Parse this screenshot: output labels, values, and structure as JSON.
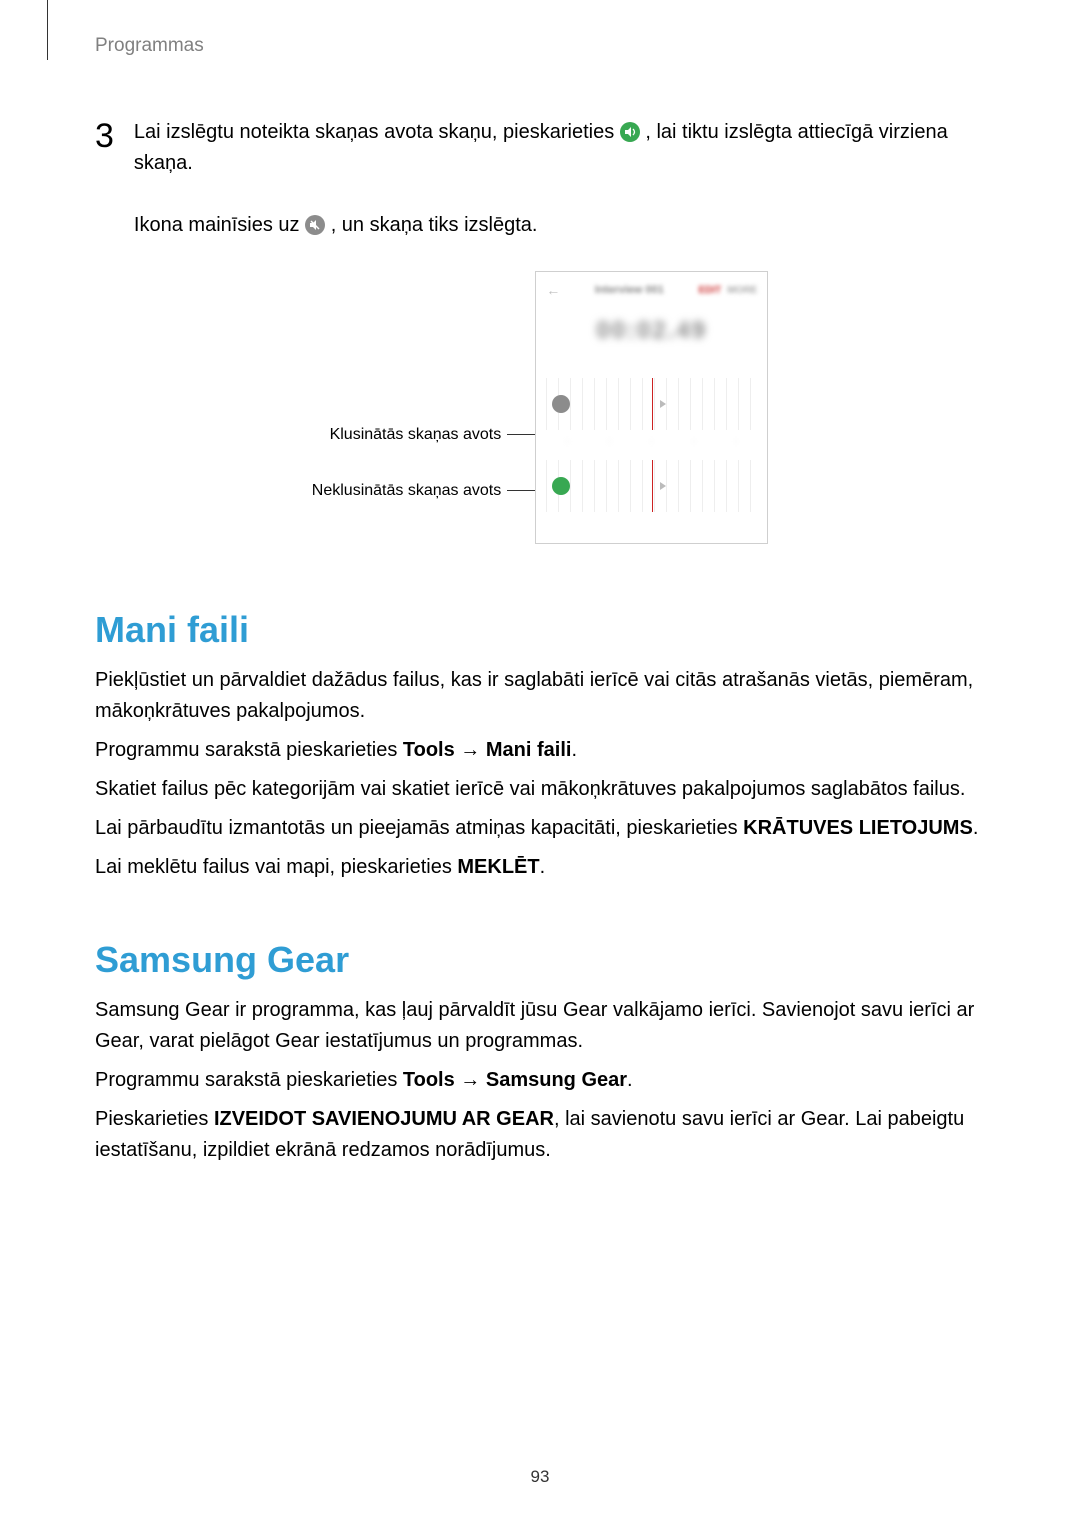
{
  "header": {
    "section": "Programmas"
  },
  "step3": {
    "number": "3",
    "line1_a": "Lai izslēgtu noteikta skaņas avota skaņu, pieskarieties ",
    "line1_b": ", lai tiktu izslēgta attiecīgā virziena skaņa.",
    "line2_a": "Ikona mainīsies uz ",
    "line2_b": ", un skaņa tiks izslēgta."
  },
  "callouts": {
    "muted": "Klusinātās skaņas avots",
    "unmuted": "Neklusinātās skaņas avots"
  },
  "screenshot": {
    "title": "Interview 001",
    "act1": "EDIT",
    "act2": "MORE",
    "time": "00:02.49"
  },
  "mani": {
    "heading": "Mani faili",
    "p1": "Piekļūstiet un pārvaldiet dažādus failus, kas ir saglabāti ierīcē vai citās atrašanās vietās, piemēram, mākoņkrātuves pakalpojumos.",
    "p2_a": "Programmu sarakstā pieskarieties ",
    "p2_b": "Tools",
    "p2_c": " → ",
    "p2_d": "Mani faili",
    "p2_e": ".",
    "p3": "Skatiet failus pēc kategorijām vai skatiet ierīcē vai mākoņkrātuves pakalpojumos saglabātos failus.",
    "p4_a": "Lai pārbaudītu izmantotās un pieejamās atmiņas kapacitāti, pieskarieties ",
    "p4_b": "KRĀTUVES LIETOJUMS",
    "p4_c": ".",
    "p5_a": "Lai meklētu failus vai mapi, pieskarieties ",
    "p5_b": "MEKLĒT",
    "p5_c": "."
  },
  "gear": {
    "heading": "Samsung Gear",
    "p1": "Samsung Gear ir programma, kas ļauj pārvaldīt jūsu Gear valkājamo ierīci. Savienojot savu ierīci ar Gear, varat pielāgot Gear iestatījumus un programmas.",
    "p2_a": "Programmu sarakstā pieskarieties ",
    "p2_b": "Tools",
    "p2_c": " → ",
    "p2_d": "Samsung Gear",
    "p2_e": ".",
    "p3_a": "Pieskarieties ",
    "p3_b": "IZVEIDOT SAVIENOJUMU AR GEAR",
    "p3_c": ", lai savienotu savu ierīci ar Gear. Lai pabeigtu iestatīšanu, izpildiet ekrānā redzamos norādījumus."
  },
  "page_number": "93"
}
